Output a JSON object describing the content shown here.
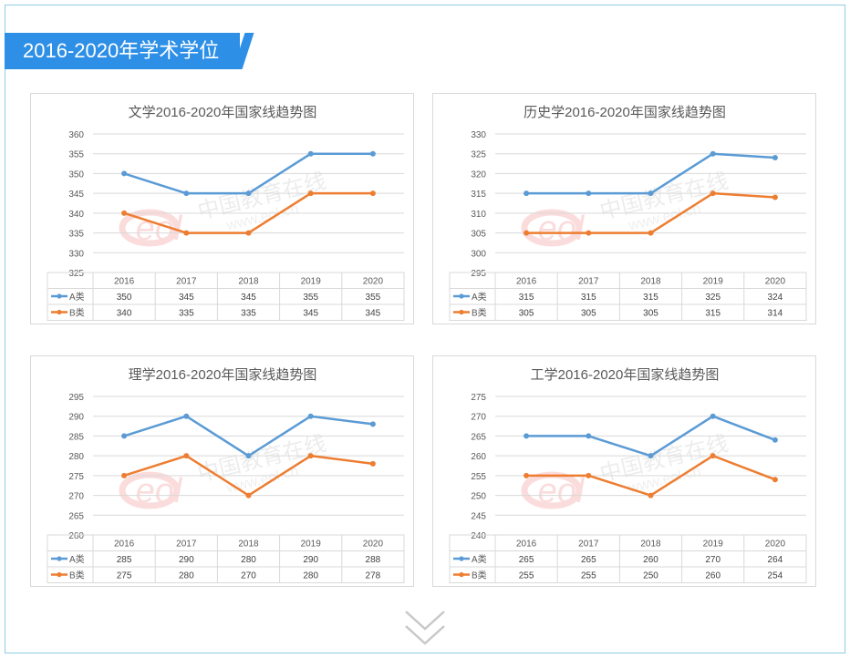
{
  "banner": {
    "title": "2016-2020年学术学位"
  },
  "watermark": {
    "text": "中国教育在线",
    "url": "www.eol.cn",
    "logo": "eol"
  },
  "colors": {
    "series_a": "#5b9bd5",
    "series_b": "#ed7d31",
    "banner": "#2d8fe6",
    "frame": "#8ecde6"
  },
  "icons": {
    "more": "double-chevron-down-icon"
  },
  "chart_data": [
    {
      "type": "line",
      "title": "文学2016-2020年国家线趋势图",
      "categories": [
        "2016",
        "2017",
        "2018",
        "2019",
        "2020"
      ],
      "ylim": [
        325,
        360
      ],
      "ystep": 5,
      "grid": true,
      "legend": "data-table",
      "series": [
        {
          "name": "A类",
          "values": [
            350,
            345,
            345,
            355,
            355
          ]
        },
        {
          "name": "B类",
          "values": [
            340,
            335,
            335,
            345,
            345
          ]
        }
      ]
    },
    {
      "type": "line",
      "title": "历史学2016-2020年国家线趋势图",
      "categories": [
        "2016",
        "2017",
        "2018",
        "2019",
        "2020"
      ],
      "ylim": [
        295,
        330
      ],
      "ystep": 5,
      "grid": true,
      "legend": "data-table",
      "series": [
        {
          "name": "A类",
          "values": [
            315,
            315,
            315,
            325,
            324
          ]
        },
        {
          "name": "B类",
          "values": [
            305,
            305,
            305,
            315,
            314
          ]
        }
      ]
    },
    {
      "type": "line",
      "title": "理学2016-2020年国家线趋势图",
      "categories": [
        "2016",
        "2017",
        "2018",
        "2019",
        "2020"
      ],
      "ylim": [
        260,
        295
      ],
      "ystep": 5,
      "grid": true,
      "legend": "data-table",
      "series": [
        {
          "name": "A类",
          "values": [
            285,
            290,
            280,
            290,
            288
          ]
        },
        {
          "name": "B类",
          "values": [
            275,
            280,
            270,
            280,
            278
          ]
        }
      ]
    },
    {
      "type": "line",
      "title": "工学2016-2020年国家线趋势图",
      "categories": [
        "2016",
        "2017",
        "2018",
        "2019",
        "2020"
      ],
      "ylim": [
        240,
        275
      ],
      "ystep": 5,
      "grid": true,
      "legend": "data-table",
      "series": [
        {
          "name": "A类",
          "values": [
            265,
            265,
            260,
            270,
            264
          ]
        },
        {
          "name": "B类",
          "values": [
            255,
            255,
            250,
            260,
            254
          ]
        }
      ]
    }
  ]
}
